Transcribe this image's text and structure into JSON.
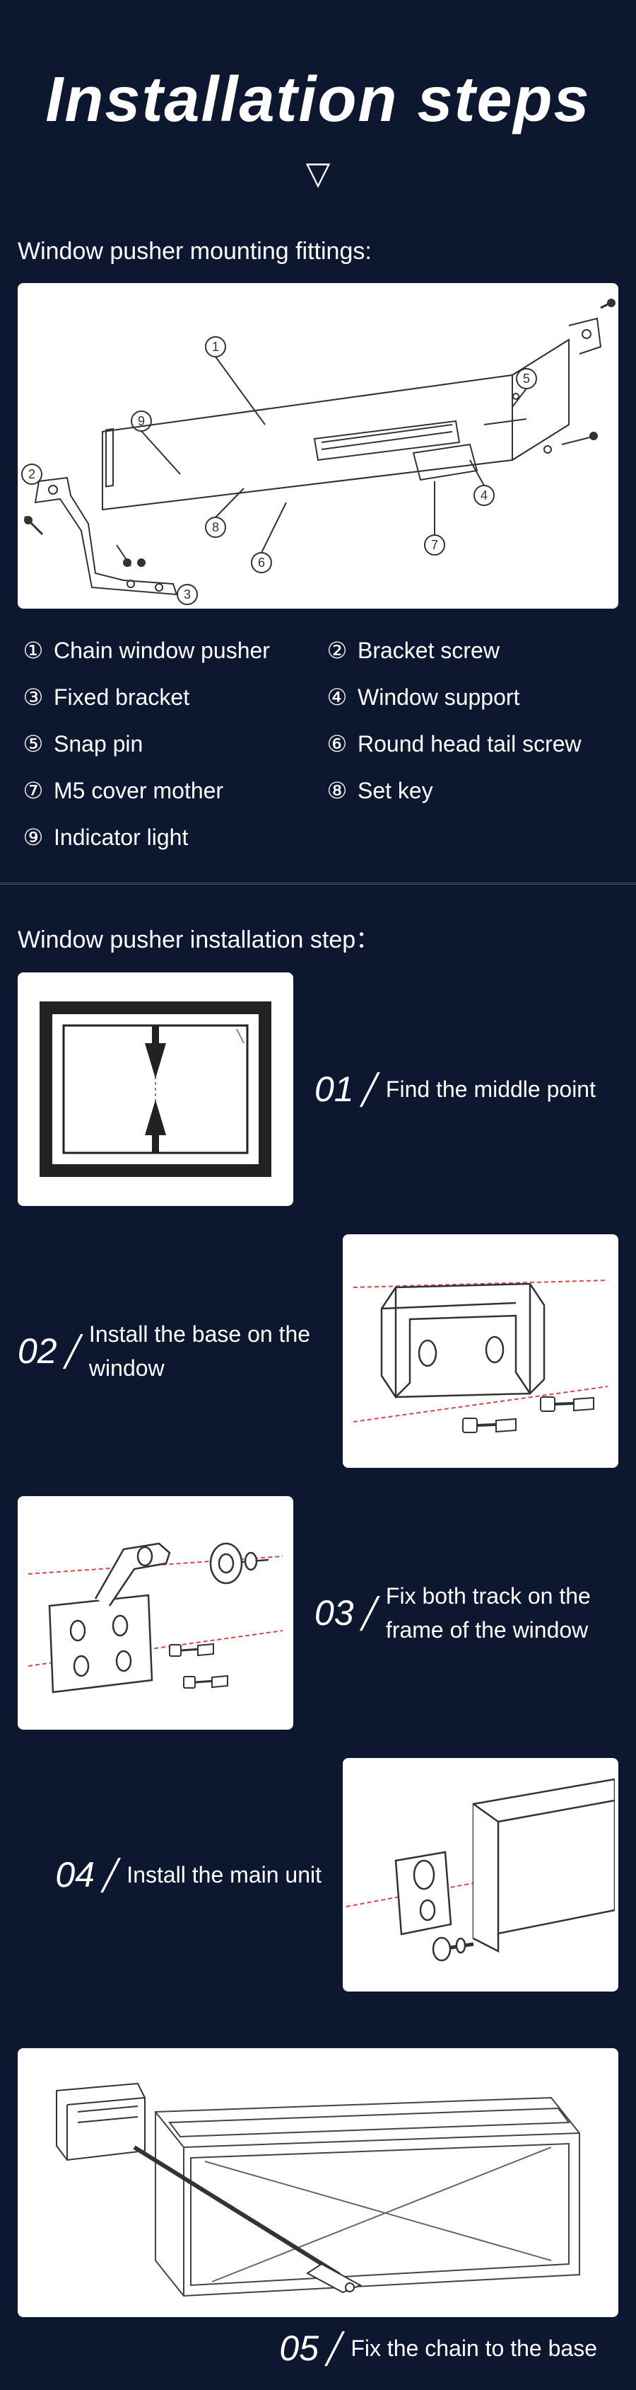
{
  "header": {
    "title": "Installation steps"
  },
  "fittings": {
    "label": "Window pusher mounting fittings:"
  },
  "legend": {
    "items": [
      {
        "num": "①",
        "text": "Chain window pusher"
      },
      {
        "num": "②",
        "text": "Bracket screw"
      },
      {
        "num": "③",
        "text": "Fixed bracket"
      },
      {
        "num": "④",
        "text": "Window support"
      },
      {
        "num": "⑤",
        "text": "Snap pin"
      },
      {
        "num": "⑥",
        "text": "Round head tail screw"
      },
      {
        "num": "⑦",
        "text": "M5 cover mother"
      },
      {
        "num": "⑧",
        "text": "Set key"
      },
      {
        "num": "⑨",
        "text": "Indicator light"
      }
    ]
  },
  "steps": {
    "label": "Window pusher installation step：",
    "items": [
      {
        "num": "01",
        "desc": "Find the middle point"
      },
      {
        "num": "02",
        "desc": "Install the base on the window"
      },
      {
        "num": "03",
        "desc": "Fix both track on the frame of the window"
      },
      {
        "num": "04",
        "desc": "Install the main unit"
      },
      {
        "num": "05",
        "desc": "Fix the chain to the base"
      }
    ]
  }
}
